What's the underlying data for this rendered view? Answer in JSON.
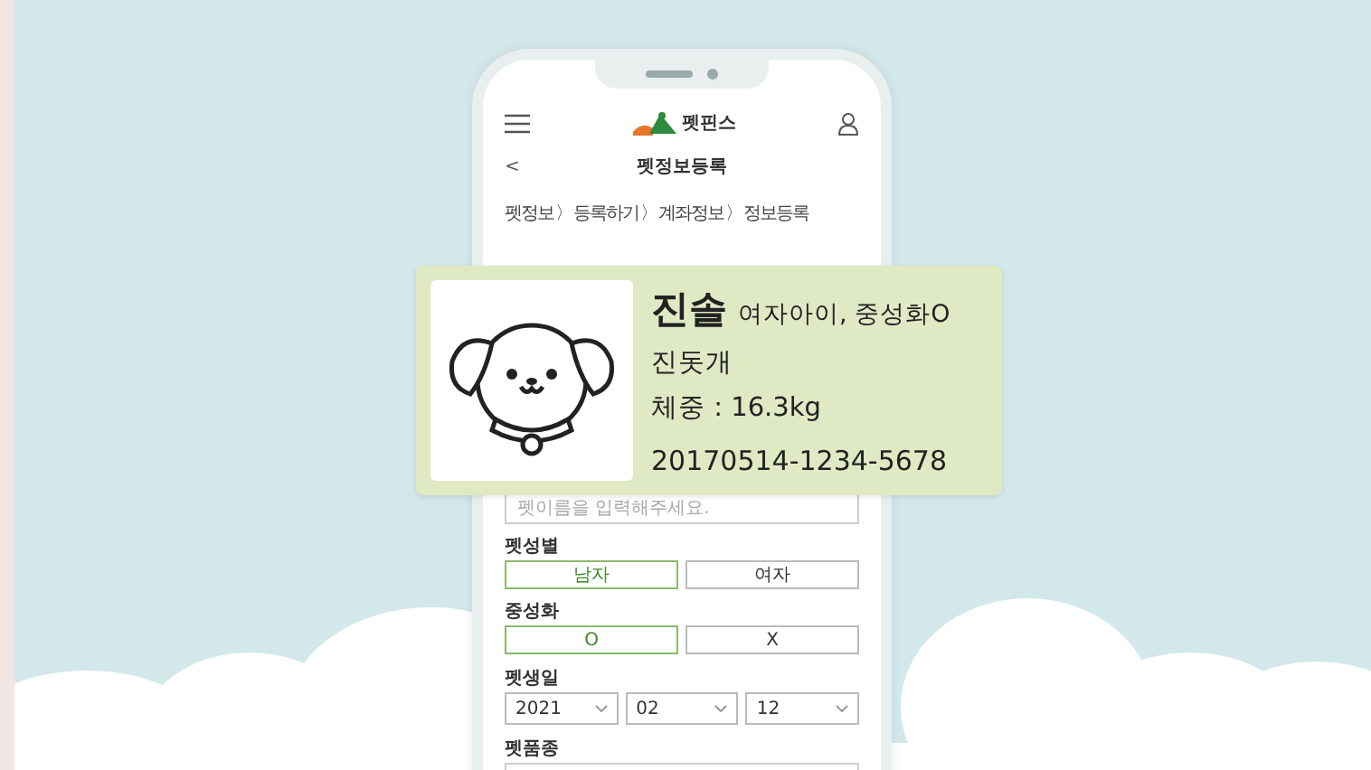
{
  "app_header": {
    "logo_text": "펫핀스"
  },
  "page_title": {
    "back": "<",
    "title": "펫정보등록"
  },
  "breadcrumb": [
    "펫정보",
    "등록하기",
    "계좌정보",
    "정보등록"
  ],
  "breadcrumb_separator": "〉",
  "name_field": {
    "placeholder": "펫이름을 입력해주세요."
  },
  "gender": {
    "label": "펫성별",
    "options": [
      {
        "label": "남자",
        "selected": true
      },
      {
        "label": "여자",
        "selected": false
      }
    ]
  },
  "neutered": {
    "label": "중성화",
    "options": [
      {
        "label": "O",
        "selected": true
      },
      {
        "label": "X",
        "selected": false
      }
    ]
  },
  "birthday": {
    "label": "펫생일",
    "selects": [
      "2021",
      "02",
      "12"
    ]
  },
  "breed": {
    "label": "펫품종"
  },
  "pet_card": {
    "name": "진솔",
    "details": "여자아이, 중성화O",
    "breed": "진돗개",
    "weight": "체중 : 16.3kg",
    "registration_number": "20170514-1234-5678"
  }
}
